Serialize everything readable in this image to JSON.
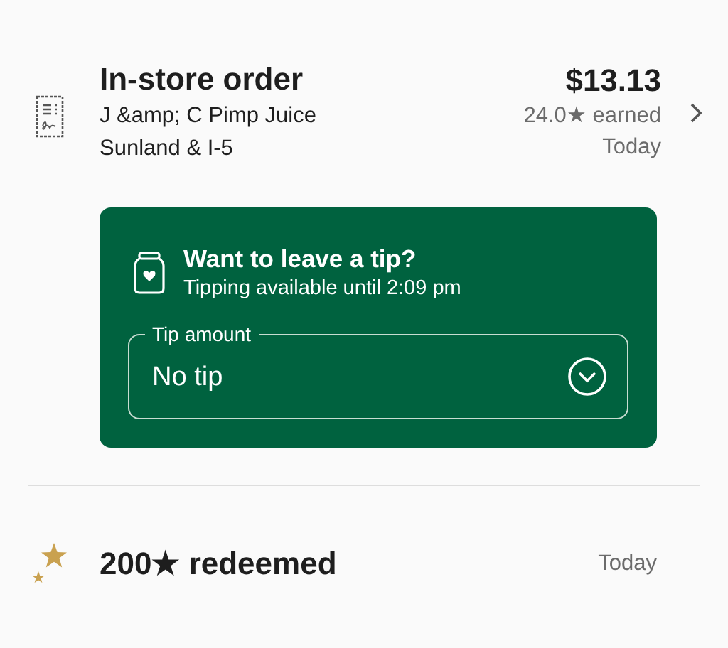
{
  "order": {
    "title": "In-store order",
    "store_name": "J &amp; C Pimp Juice",
    "store_location": "Sunland & I-5",
    "amount": "$13.13",
    "stars_earned": "24.0★ earned",
    "date": "Today"
  },
  "tip_card": {
    "title": "Want to leave a tip?",
    "subtitle": "Tipping available until 2:09 pm",
    "field": {
      "label": "Tip amount",
      "value": "No tip"
    }
  },
  "redemption": {
    "title": "200★ redeemed",
    "date": "Today"
  }
}
